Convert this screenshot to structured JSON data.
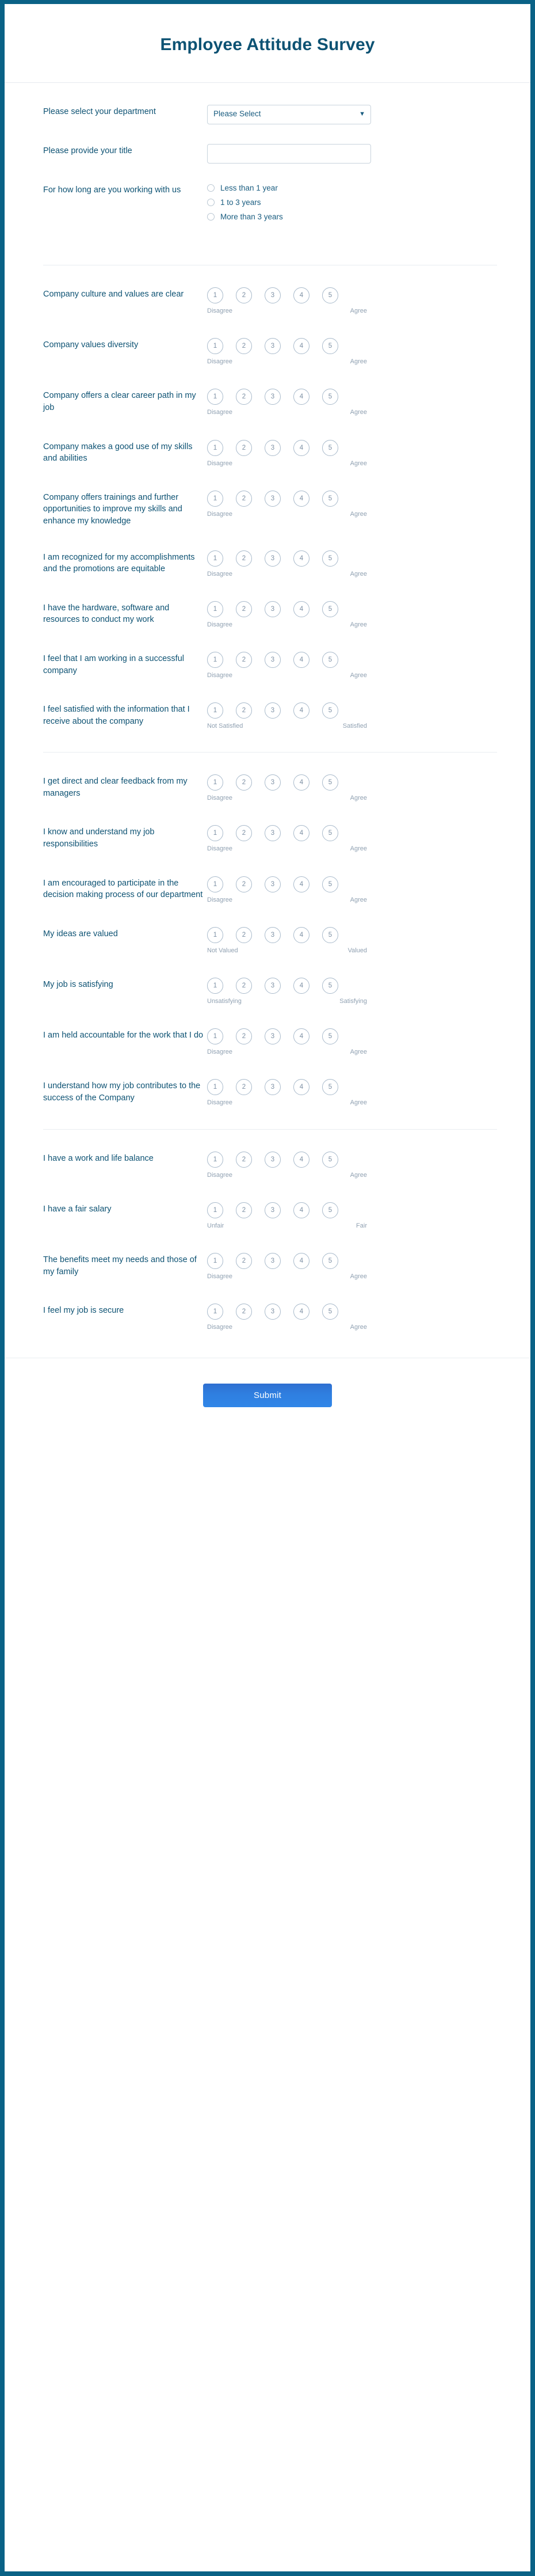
{
  "header": {
    "title": "Employee Attitude Survey"
  },
  "intro": {
    "department": {
      "label": "Please select your department",
      "value": "Please Select",
      "options": [
        "Please Select"
      ],
      "chevron_icon": "chevron-down-icon"
    },
    "job_title": {
      "label": "Please provide your title",
      "value": "",
      "placeholder": ""
    },
    "tenure": {
      "label": "For how long are you working with us",
      "options": [
        "Less than 1 year",
        "1 to 3 years",
        "More than 3 years"
      ]
    }
  },
  "scale_numbers": [
    "1",
    "2",
    "3",
    "4",
    "5"
  ],
  "sections": [
    {
      "questions": [
        {
          "label": "Company culture and values are clear",
          "low": "Disagree",
          "high": "Agree"
        },
        {
          "label": "Company values diversity",
          "low": "Disagree",
          "high": "Agree"
        },
        {
          "label": "Company offers a clear career path in my job",
          "low": "Disagree",
          "high": "Agree"
        },
        {
          "label": "Company makes a good use of my skills and abilities",
          "low": "Disagree",
          "high": "Agree"
        },
        {
          "label": "Company offers trainings and further opportunities to improve my skills and enhance my knowledge",
          "low": "Disagree",
          "high": "Agree"
        },
        {
          "label": "I am recognized for my accomplishments and the promotions are equitable",
          "low": "Disagree",
          "high": "Agree"
        },
        {
          "label": "I have the hardware, software and resources to conduct my work",
          "low": "Disagree",
          "high": "Agree"
        },
        {
          "label": "I feel that I am working in a successful company",
          "low": "Disagree",
          "high": "Agree"
        },
        {
          "label": "I feel satisfied with the information that I receive about the company",
          "low": "Not Satisfied",
          "high": "Satisfied"
        }
      ]
    },
    {
      "questions": [
        {
          "label": "I get direct and clear feedback from my managers",
          "low": "Disagree",
          "high": "Agree"
        },
        {
          "label": "I know and understand my job responsibilities",
          "low": "Disagree",
          "high": "Agree"
        },
        {
          "label": "I am encouraged to participate in the decision making process of our department",
          "low": "Disagree",
          "high": "Agree"
        },
        {
          "label": "My ideas are valued",
          "low": "Not Valued",
          "high": "Valued"
        },
        {
          "label": "My job is satisfying",
          "low": "Unsatisfying",
          "high": "Satisfying"
        },
        {
          "label": "I am held accountable for the work that I do",
          "low": "Disagree",
          "high": "Agree"
        },
        {
          "label": "I understand how my job contributes to the success of the Company",
          "low": "Disagree",
          "high": "Agree"
        }
      ]
    },
    {
      "questions": [
        {
          "label": "I have a work and life balance",
          "low": "Disagree",
          "high": "Agree"
        },
        {
          "label": "I have a fair salary",
          "low": "Unfair",
          "high": "Fair"
        },
        {
          "label": "The benefits meet my needs and those of my family",
          "low": "Disagree",
          "high": "Agree"
        },
        {
          "label": "I feel my job is secure",
          "low": "Disagree",
          "high": "Agree"
        }
      ]
    }
  ],
  "footer": {
    "submit_label": "Submit"
  },
  "colors": {
    "border": "#0a6286",
    "title": "#0d5273",
    "label": "#0d5273",
    "circle_border": "#a9bacb",
    "endpoint_text": "#90a1b2",
    "submit": "#2f7fe0"
  }
}
